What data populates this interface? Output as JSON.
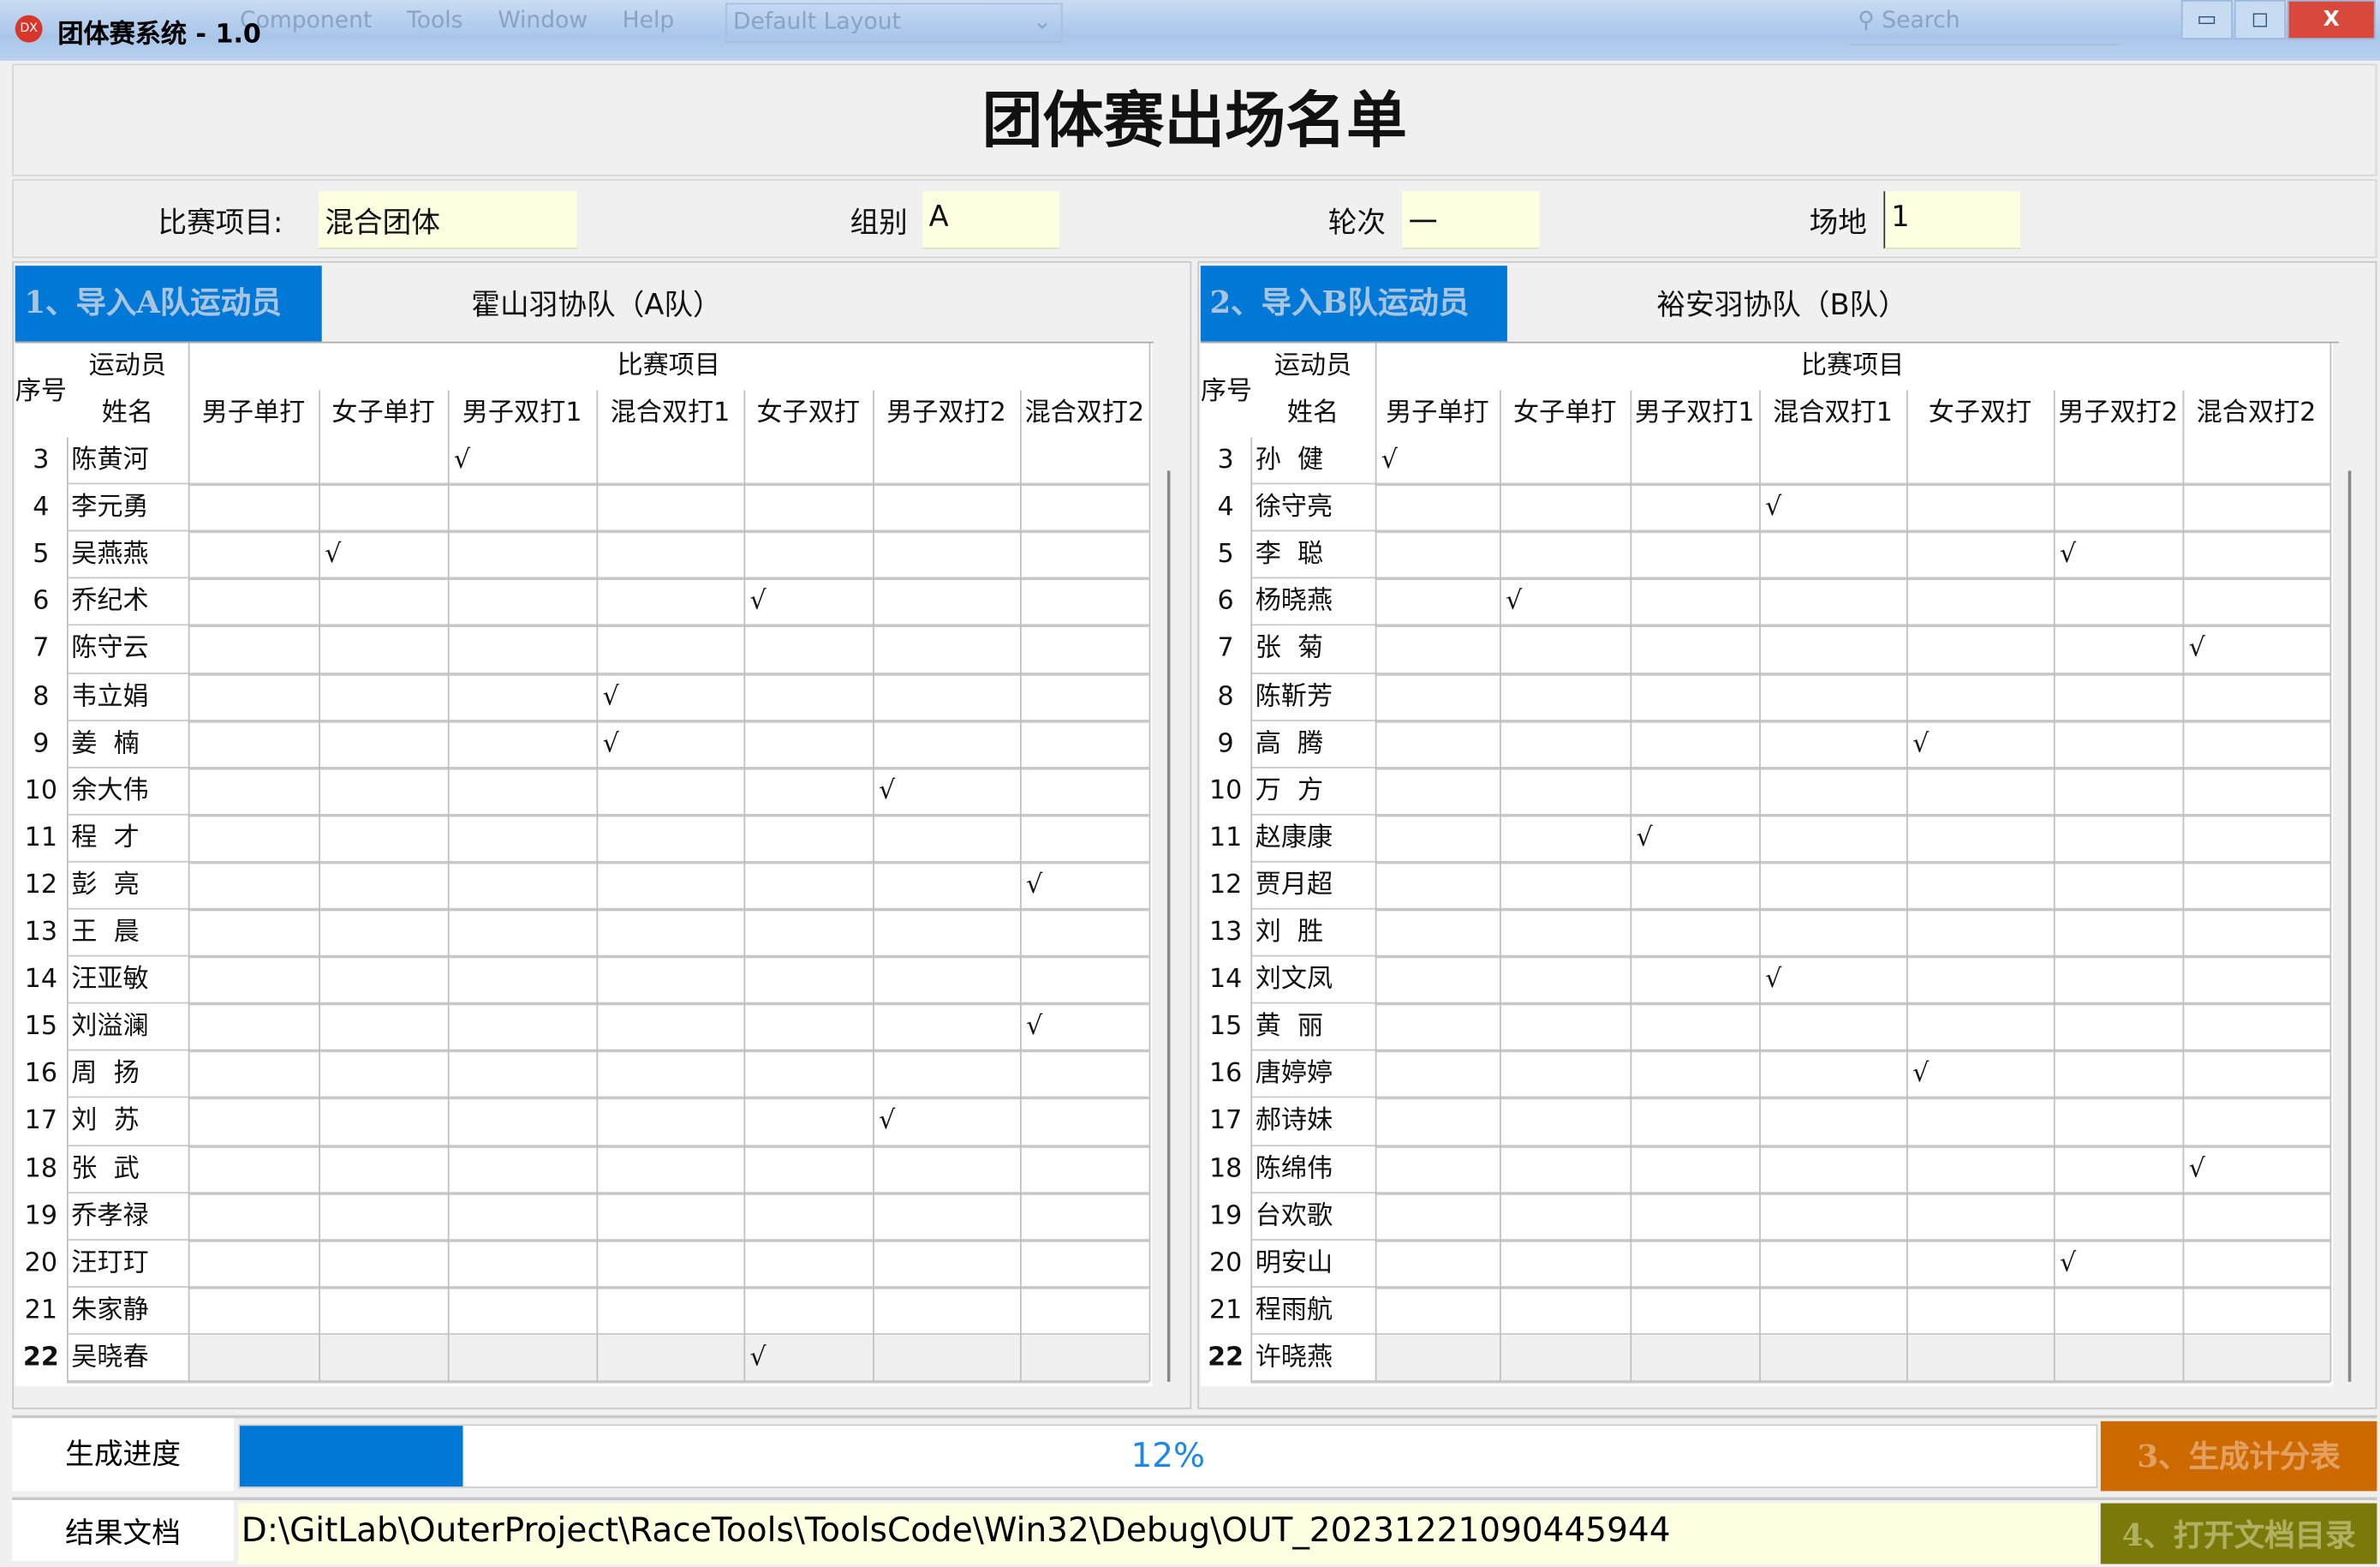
{
  "window": {
    "title": "团体赛系统 - 1.0",
    "app_icon": "DX",
    "menu_ghost": [
      "Component",
      "Tools",
      "Window",
      "Help"
    ],
    "layout": "Default Layout",
    "search_placeholder": "Search",
    "minimize": "▭",
    "maximize": "◻",
    "close": "X"
  },
  "heading": "团体赛出场名单",
  "info": {
    "event_label": "比赛项目:",
    "event_value": "混合团体",
    "group_label": "组别",
    "group_value": "A",
    "round_label": "轮次",
    "round_value": "一",
    "venue_label": "场地",
    "venue_value": "1"
  },
  "table_headers": {
    "seq": "序号",
    "athlete": "运动员",
    "name": "姓名",
    "events_group": "比赛项目",
    "events": [
      "男子单打",
      "女子单打",
      "男子双打1",
      "混合双打1",
      "女子双打",
      "男子双打2",
      "混合双打2"
    ]
  },
  "team_a": {
    "import_button": "1、导入A队运动员",
    "team_name": "霍山羽协队（A队）",
    "rows": [
      {
        "seq": "3",
        "name": "陈黄河",
        "marks": [
          "",
          "",
          "√",
          "",
          "",
          "",
          ""
        ]
      },
      {
        "seq": "4",
        "name": "李元勇",
        "marks": [
          "",
          "",
          "",
          "",
          "",
          "",
          ""
        ]
      },
      {
        "seq": "5",
        "name": "吴燕燕",
        "marks": [
          "",
          "√",
          "",
          "",
          "",
          "",
          ""
        ]
      },
      {
        "seq": "6",
        "name": "乔纪术",
        "marks": [
          "",
          "",
          "",
          "",
          "√",
          "",
          ""
        ]
      },
      {
        "seq": "7",
        "name": "陈守云",
        "marks": [
          "",
          "",
          "",
          "",
          "",
          "",
          ""
        ]
      },
      {
        "seq": "8",
        "name": "韦立娟",
        "marks": [
          "",
          "",
          "",
          "√",
          "",
          "",
          ""
        ]
      },
      {
        "seq": "9",
        "name": "姜  楠",
        "marks": [
          "",
          "",
          "",
          "√",
          "",
          "",
          ""
        ]
      },
      {
        "seq": "10",
        "name": "余大伟",
        "marks": [
          "",
          "",
          "",
          "",
          "",
          "√",
          ""
        ]
      },
      {
        "seq": "11",
        "name": "程  才",
        "marks": [
          "",
          "",
          "",
          "",
          "",
          "",
          ""
        ]
      },
      {
        "seq": "12",
        "name": "彭  亮",
        "marks": [
          "",
          "",
          "",
          "",
          "",
          "",
          "√"
        ]
      },
      {
        "seq": "13",
        "name": "王  晨",
        "marks": [
          "",
          "",
          "",
          "",
          "",
          "",
          ""
        ]
      },
      {
        "seq": "14",
        "name": "汪亚敏",
        "marks": [
          "",
          "",
          "",
          "",
          "",
          "",
          ""
        ]
      },
      {
        "seq": "15",
        "name": "刘溢澜",
        "marks": [
          "",
          "",
          "",
          "",
          "",
          "",
          "√"
        ]
      },
      {
        "seq": "16",
        "name": "周  扬",
        "marks": [
          "",
          "",
          "",
          "",
          "",
          "",
          ""
        ]
      },
      {
        "seq": "17",
        "name": "刘  苏",
        "marks": [
          "",
          "",
          "",
          "",
          "",
          "√",
          ""
        ]
      },
      {
        "seq": "18",
        "name": "张  武",
        "marks": [
          "",
          "",
          "",
          "",
          "",
          "",
          ""
        ]
      },
      {
        "seq": "19",
        "name": "乔孝禄",
        "marks": [
          "",
          "",
          "",
          "",
          "",
          "",
          ""
        ]
      },
      {
        "seq": "20",
        "name": "汪玎玎",
        "marks": [
          "",
          "",
          "",
          "",
          "",
          "",
          ""
        ]
      },
      {
        "seq": "21",
        "name": "朱家静",
        "marks": [
          "",
          "",
          "",
          "",
          "",
          "",
          ""
        ]
      },
      {
        "seq": "22",
        "name": "吴晓春",
        "marks": [
          "",
          "",
          "",
          "",
          "√",
          "",
          ""
        ],
        "selected": true
      }
    ]
  },
  "team_b": {
    "import_button": "2、导入B队运动员",
    "team_name": "裕安羽协队（B队）",
    "rows": [
      {
        "seq": "3",
        "name": "孙  健",
        "marks": [
          "√",
          "",
          "",
          "",
          "",
          "",
          ""
        ]
      },
      {
        "seq": "4",
        "name": "徐守亮",
        "marks": [
          "",
          "",
          "",
          "√",
          "",
          "",
          ""
        ]
      },
      {
        "seq": "5",
        "name": "李  聪",
        "marks": [
          "",
          "",
          "",
          "",
          "",
          "√",
          ""
        ]
      },
      {
        "seq": "6",
        "name": "杨晓燕",
        "marks": [
          "",
          "√",
          "",
          "",
          "",
          "",
          ""
        ]
      },
      {
        "seq": "7",
        "name": "张  菊",
        "marks": [
          "",
          "",
          "",
          "",
          "",
          "",
          "√"
        ]
      },
      {
        "seq": "8",
        "name": "陈靳芳",
        "marks": [
          "",
          "",
          "",
          "",
          "",
          "",
          ""
        ]
      },
      {
        "seq": "9",
        "name": "高  腾",
        "marks": [
          "",
          "",
          "",
          "",
          "√",
          "",
          ""
        ]
      },
      {
        "seq": "10",
        "name": "万  方",
        "marks": [
          "",
          "",
          "",
          "",
          "",
          "",
          ""
        ]
      },
      {
        "seq": "11",
        "name": "赵康康",
        "marks": [
          "",
          "",
          "√",
          "",
          "",
          "",
          ""
        ]
      },
      {
        "seq": "12",
        "name": "贾月超",
        "marks": [
          "",
          "",
          "",
          "",
          "",
          "",
          ""
        ]
      },
      {
        "seq": "13",
        "name": "刘  胜",
        "marks": [
          "",
          "",
          "",
          "",
          "",
          "",
          ""
        ]
      },
      {
        "seq": "14",
        "name": "刘文凤",
        "marks": [
          "",
          "",
          "",
          "√",
          "",
          "",
          ""
        ]
      },
      {
        "seq": "15",
        "name": "黄  丽",
        "marks": [
          "",
          "",
          "",
          "",
          "",
          "",
          ""
        ]
      },
      {
        "seq": "16",
        "name": "唐婷婷",
        "marks": [
          "",
          "",
          "",
          "",
          "√",
          "",
          ""
        ]
      },
      {
        "seq": "17",
        "name": "郝诗妹",
        "marks": [
          "",
          "",
          "",
          "",
          "",
          "",
          ""
        ]
      },
      {
        "seq": "18",
        "name": "陈绵伟",
        "marks": [
          "",
          "",
          "",
          "",
          "",
          "",
          "√"
        ]
      },
      {
        "seq": "19",
        "name": "台欢歌",
        "marks": [
          "",
          "",
          "",
          "",
          "",
          "",
          ""
        ]
      },
      {
        "seq": "20",
        "name": "明安山",
        "marks": [
          "",
          "",
          "",
          "",
          "",
          "√",
          ""
        ]
      },
      {
        "seq": "21",
        "name": "程雨航",
        "marks": [
          "",
          "",
          "",
          "",
          "",
          "",
          ""
        ]
      },
      {
        "seq": "22",
        "name": "许晓燕",
        "marks": [
          "",
          "",
          "",
          "",
          "",
          "",
          ""
        ],
        "selected": true
      }
    ]
  },
  "progress": {
    "label": "生成进度",
    "percent": 12,
    "text": "12%",
    "button": "3、生成计分表"
  },
  "result": {
    "label": "结果文档",
    "path": "D:\\GitLab\\OuterProject\\RaceTools\\ToolsCode\\Win32\\Debug\\OUT_20231221090445944",
    "button": "4、打开文档目录"
  },
  "colors": {
    "accent": "#0078d7",
    "generate_button": "#cc6a00",
    "open_button": "#7a7a0a",
    "input_bg": "#ffffe1",
    "progress_text": "#1e88e5"
  }
}
